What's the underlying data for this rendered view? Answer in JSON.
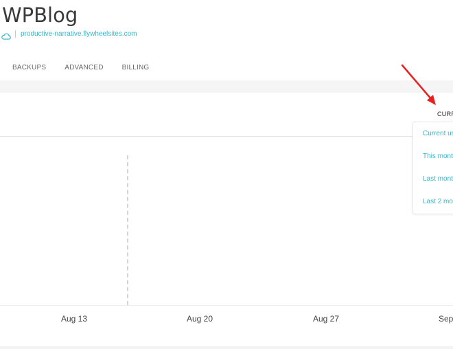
{
  "site": {
    "title": "WPBlog",
    "url": "productive-narrative.flywheelsites.com"
  },
  "tabs": [
    {
      "label": "BACKUPS"
    },
    {
      "label": "ADVANCED"
    },
    {
      "label": "BILLING"
    }
  ],
  "period_selector": {
    "label": "CURR",
    "options": [
      {
        "label": "Current us"
      },
      {
        "label": "This mont"
      },
      {
        "label": "Last montl"
      },
      {
        "label": "Last 2 mor"
      }
    ]
  },
  "chart_data": {
    "type": "line",
    "x_tick_labels": [
      "Aug 13",
      "Aug 20",
      "Aug 27",
      "Sep"
    ],
    "series": []
  },
  "colors": {
    "accent": "#36b6c8",
    "annotation_arrow": "#e8201f"
  },
  "icons": {
    "site_icon": "cloud-icon"
  }
}
